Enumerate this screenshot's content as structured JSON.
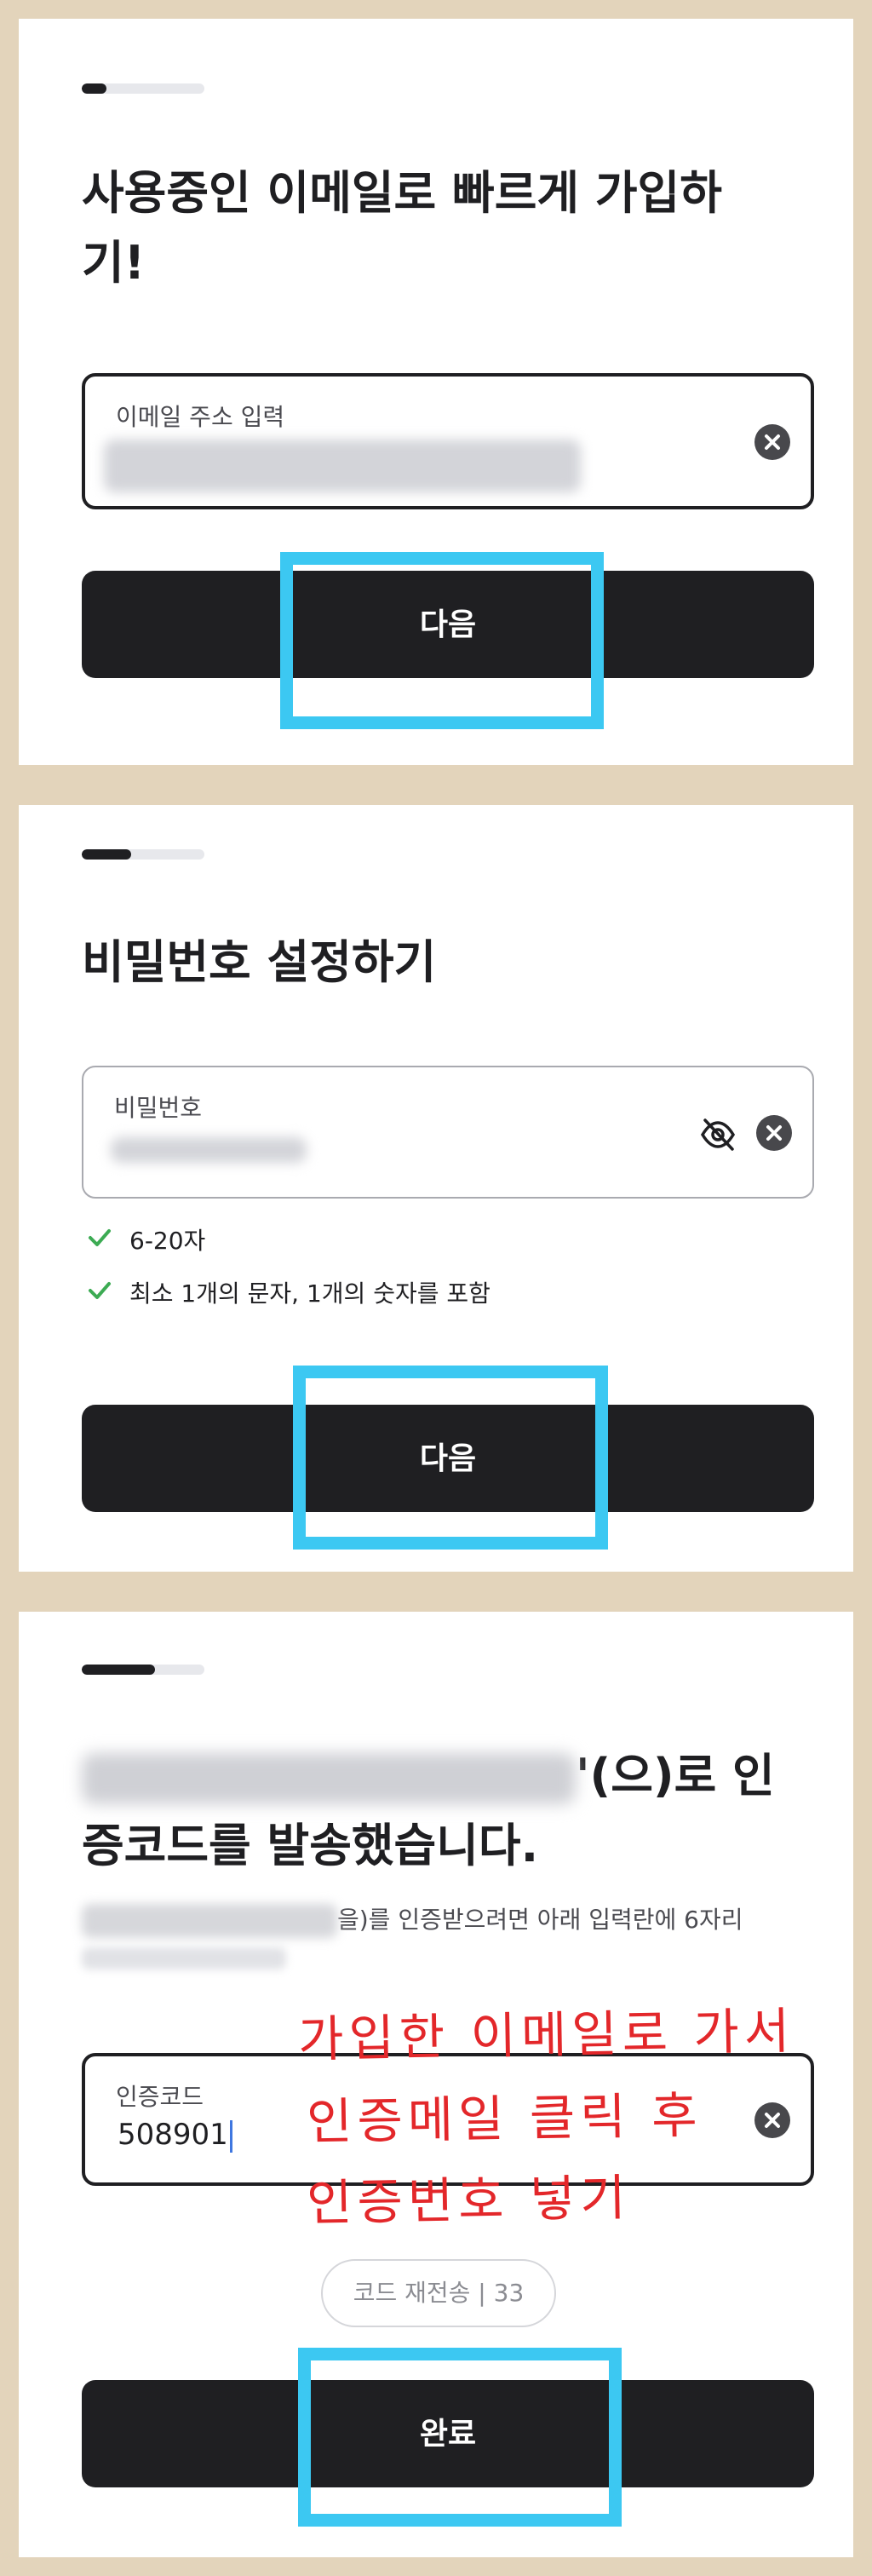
{
  "step1": {
    "progress": 0.2,
    "title_line1": "사용중인 이메일로 빠르게 가입하",
    "title_line2": "기!",
    "email_field": {
      "label": "이메일 주소 입력"
    },
    "next_label": "다음"
  },
  "step2": {
    "progress": 0.4,
    "title": "비밀번호 설정하기",
    "password_field": {
      "label": "비밀번호"
    },
    "rules": [
      {
        "text": "6-20자"
      },
      {
        "text": "최소 1개의 문자, 1개의 숫자를 포함"
      }
    ],
    "next_label": "다음"
  },
  "step3": {
    "progress": 0.6,
    "title_line1_suffix": "'(으)로 인",
    "title_line2": "증코드를 발송했습니다.",
    "subtitle_visible": "을)를 인증받으려면 아래 입력란에 6자리",
    "code_field": {
      "label": "인증코드",
      "value": "508901"
    },
    "resend_label": "코드 재전송 | 33",
    "submit_label": "완료"
  },
  "annotation": {
    "lines": [
      "가입한 이메일로 가서",
      "인증메일 클릭 후",
      "인증번호 넣기"
    ],
    "color": "#e3272a"
  },
  "colors": {
    "highlight": "#3cc8f2",
    "button": "#1f1f22",
    "check": "#3cab53",
    "background": "#e3d4bb"
  },
  "icons": [
    "clear-icon",
    "eye-off-icon",
    "check-icon"
  ]
}
